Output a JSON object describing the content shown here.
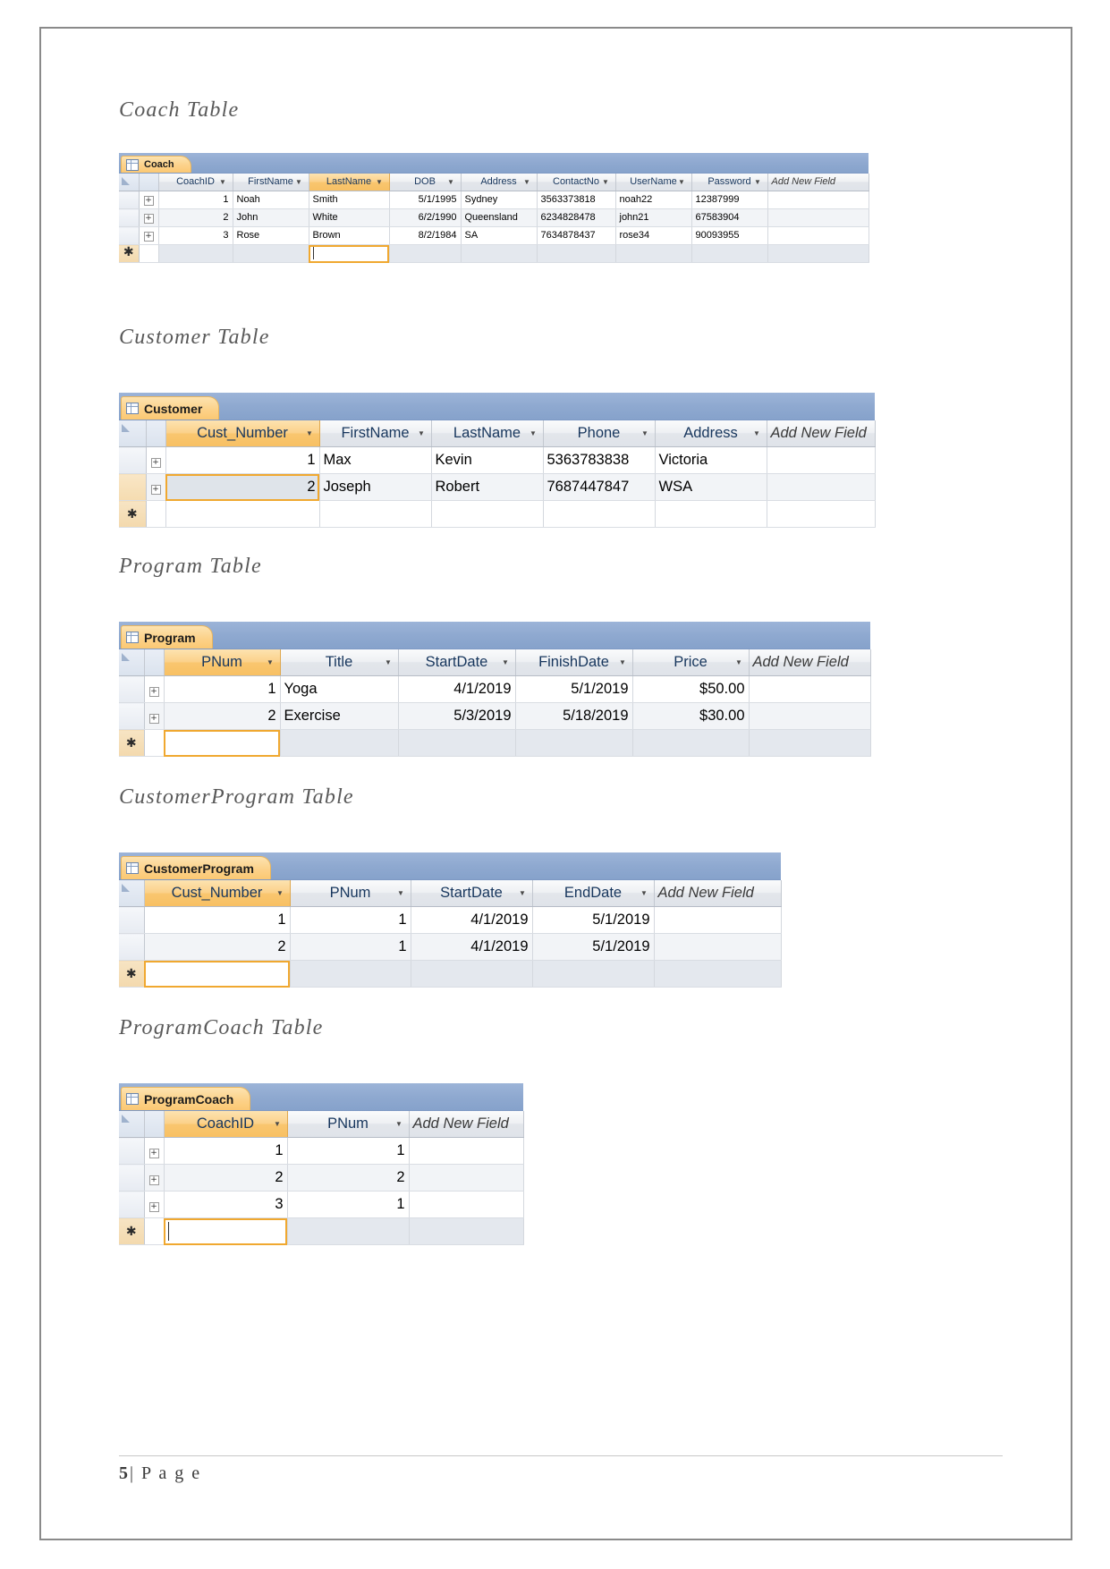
{
  "document": {
    "footer_page_number": "5",
    "footer_separator": "|",
    "footer_label": "P a g e"
  },
  "sections": [
    {
      "caption": "Coach Table",
      "table": {
        "tab_label": "Coach",
        "tab_icon": "table-icon",
        "key_column_index": 2,
        "add_new_field": "Add New Field",
        "columns": [
          "CoachID",
          "FirstName",
          "LastName",
          "DOB",
          "Address",
          "ContactNo",
          "UserName",
          "Password"
        ],
        "rows": [
          [
            "1",
            "Noah",
            "Smith",
            "5/1/1995",
            "Sydney",
            "3563373818",
            "noah22",
            "12387999"
          ],
          [
            "2",
            "John",
            "White",
            "6/2/1990",
            "Queensland",
            "6234828478",
            "john21",
            "67583904"
          ],
          [
            "3",
            "Rose",
            "Brown",
            "8/2/1984",
            "SA",
            "7634878437",
            "rose34",
            "90093955"
          ]
        ]
      }
    },
    {
      "caption": "Customer Table",
      "table": {
        "tab_label": "Customer",
        "tab_icon": "table-icon",
        "key_column_index": 0,
        "add_new_field": "Add New Field",
        "columns": [
          "Cust_Number",
          "FirstName",
          "LastName",
          "Phone",
          "Address"
        ],
        "rows": [
          [
            "1",
            "Max",
            "Kevin",
            "5363783838",
            "Victoria"
          ],
          [
            "2",
            "Joseph",
            "Robert",
            "7687447847",
            "WSA"
          ]
        ]
      }
    },
    {
      "caption": "Program Table",
      "table": {
        "tab_label": "Program",
        "tab_icon": "table-icon",
        "key_column_index": 0,
        "add_new_field": "Add New Field",
        "columns": [
          "PNum",
          "Title",
          "StartDate",
          "FinishDate",
          "Price"
        ],
        "rows": [
          [
            "1",
            "Yoga",
            "4/1/2019",
            "5/1/2019",
            "$50.00"
          ],
          [
            "2",
            "Exercise",
            "5/3/2019",
            "5/18/2019",
            "$30.00"
          ]
        ]
      }
    },
    {
      "caption": "CustomerProgram Table",
      "table": {
        "tab_label": "CustomerProgram",
        "tab_icon": "table-icon",
        "key_column_index": 0,
        "add_new_field": "Add New Field",
        "columns": [
          "Cust_Number",
          "PNum",
          "StartDate",
          "EndDate"
        ],
        "rows": [
          [
            "1",
            "1",
            "4/1/2019",
            "5/1/2019"
          ],
          [
            "2",
            "1",
            "4/1/2019",
            "5/1/2019"
          ]
        ]
      }
    },
    {
      "caption": "ProgramCoach Table",
      "table": {
        "tab_label": "ProgramCoach",
        "tab_icon": "table-icon",
        "key_column_index": 0,
        "add_new_field": "Add New Field",
        "columns": [
          "CoachID",
          "PNum"
        ],
        "rows": [
          [
            "1",
            "1"
          ],
          [
            "2",
            "2"
          ],
          [
            "3",
            "1"
          ]
        ]
      }
    }
  ],
  "glyphs": {
    "expand_row": "+",
    "new_record": "✱",
    "sort_arrow": "▼"
  },
  "colors": {
    "tab_accent": "#fbc873",
    "header_blue": "#8fa9d0",
    "key_column": "#f8c063",
    "selection_outline": "#f0a830",
    "header_text": "#17365d"
  }
}
